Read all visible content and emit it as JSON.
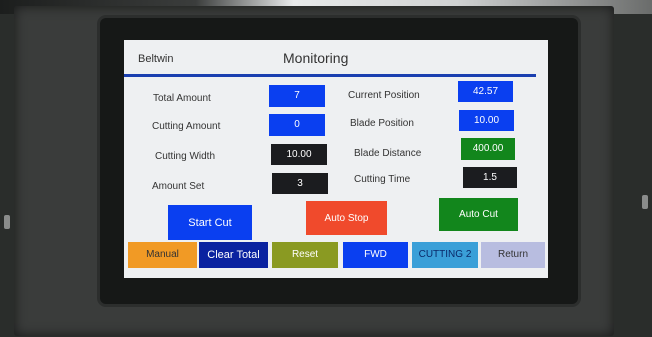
{
  "header": {
    "brand": "Beltwin",
    "title": "Monitoring"
  },
  "left_fields": [
    {
      "label": "Total Amount",
      "value": "7"
    },
    {
      "label": "Cutting Amount",
      "value": "0"
    },
    {
      "label": "Cutting Width",
      "value": "10.00"
    },
    {
      "label": "Amount Set",
      "value": "3"
    }
  ],
  "right_fields": [
    {
      "label": "Current Position",
      "value": "42.57"
    },
    {
      "label": "Blade Position",
      "value": "10.00"
    },
    {
      "label": "Blade Distance",
      "value": "400.00"
    },
    {
      "label": "Cutting Time",
      "value": "1.5"
    }
  ],
  "actions": {
    "start_cut": "Start Cut",
    "auto_stop": "Auto Stop",
    "auto_cut": "Auto Cut"
  },
  "tabs": [
    "Manual",
    "Clear Total",
    "Reset",
    "FWD",
    "CUTTING 2",
    "Return"
  ],
  "colors": {
    "accent_blue": "#0a3ff0",
    "stop_red": "#f04a2c",
    "go_green": "#12861c",
    "manual_orange": "#f19a25",
    "reset_olive": "#8a9a22",
    "cutting2_teal": "#3a9fd8",
    "return_lilac": "#b8bde0"
  }
}
